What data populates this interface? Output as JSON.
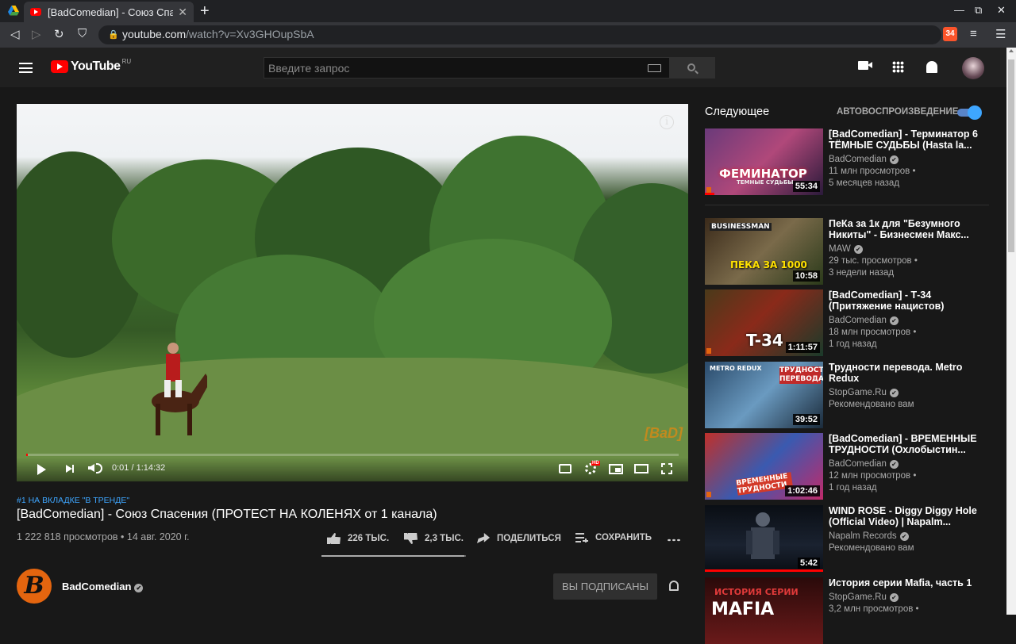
{
  "browser": {
    "tab_title": "[BadComedian] - Союз Спа",
    "tab_close": "✕",
    "new_tab": "+",
    "url_host": "youtube.com",
    "url_path": "/watch?v=Xv3GHOupSbA",
    "brave_badge": "34"
  },
  "header": {
    "logo_text": "YouTube",
    "region": "RU",
    "search_placeholder": "Введите запрос"
  },
  "player": {
    "current_time": "0:01",
    "duration": "1:14:32",
    "timecode": "0:01 / 1:14:32",
    "progress": 0.0002,
    "watermark": "[BaD]",
    "hd_badge": "HD",
    "info_icon": "i"
  },
  "video": {
    "trend_tag": "#1 НА ВКЛАДКЕ \"В ТРЕНДЕ\"",
    "title": "[BadComedian] - Союз Спасения (ПРОТЕСТ НА КОЛЕНЯХ от 1 канала)",
    "views_date": "1 222 818 просмотров • 14 авг. 2020 г.",
    "likes": "226 ТЫС.",
    "dislikes": "2,3 ТЫС.",
    "share_label": "ПОДЕЛИТЬСЯ",
    "save_label": "СОХРАНИТЬ",
    "like_ratio": 0.99
  },
  "channel": {
    "name": "BadComedian",
    "avatar_letter": "B",
    "verified": "✔",
    "subscribed_label": "ВЫ ПОДПИСАНЫ"
  },
  "sidebar": {
    "up_next_label": "Следующее",
    "autoplay_label": "АВТОВОСПРОИЗВЕДЕНИЕ",
    "autoplay_on": true,
    "recommendations": [
      {
        "title": "[BadComedian] - Терминатор 6 ТЁМНЫЕ СУДЬБЫ (Hasta la...",
        "channel": "BadComedian",
        "line1": "11 млн просмотров •",
        "line2": "5 месяцев назад",
        "duration": "55:34",
        "thumb_text": "ФЕМИНАТОР",
        "thumb_sub": "ТЕМНЫЕ СУДЬБЫ",
        "watched": 0.08
      },
      {
        "title": "ПеКа за 1к для \"Безумного Никиты\" - Бизнесмен Макс...",
        "channel": "MAW",
        "line1": "29 тыс. просмотров •",
        "line2": "3 недели назад",
        "duration": "10:58",
        "thumb_text": "ПЕКА ЗА 1000",
        "thumb_sub": "BUSINESSMAN",
        "watched": 0
      },
      {
        "title": "[BadComedian] - Т-34 (Притяжение нацистов)",
        "channel": "BadComedian",
        "line1": "18 млн просмотров •",
        "line2": "1 год назад",
        "duration": "1:11:57",
        "thumb_text": "T-34",
        "thumb_sub": "",
        "watched": 0
      },
      {
        "title": "Трудности перевода. Metro Redux",
        "channel": "StopGame.Ru",
        "line1": "Рекомендовано вам",
        "line2": "",
        "duration": "39:52",
        "thumb_text": "ТРУДНОСТИ ПЕРЕВОДА",
        "thumb_sub": "METRO REDUX",
        "watched": 0
      },
      {
        "title": "[BadComedian] - ВРЕМЕННЫЕ ТРУДНОСТИ (Охлобыстин...",
        "channel": "BadComedian",
        "line1": "12 млн просмотров •",
        "line2": "1 год назад",
        "duration": "1:02:46",
        "thumb_text": "ВРЕМЕННЫЕ ТРУДНОСТИ",
        "thumb_sub": "",
        "watched": 0
      },
      {
        "title": "WIND ROSE - Diggy Diggy Hole (Official Video) | Napalm...",
        "channel": "Napalm Records",
        "line1": "Рекомендовано вам",
        "line2": "",
        "duration": "5:42",
        "thumb_text": "",
        "thumb_sub": "",
        "watched": 1.0
      },
      {
        "title": "История серии Mafia, часть 1",
        "channel": "StopGame.Ru",
        "line1": "3,2 млн просмотров •",
        "line2": "",
        "duration": "",
        "thumb_text": "MAFIA",
        "thumb_sub": "ИСТОРИЯ СЕРИИ",
        "watched": 0
      }
    ]
  },
  "colors": {
    "background": "#181818",
    "header": "#202020",
    "accent_red": "#ff0000",
    "link_blue": "#3ea6ff"
  }
}
